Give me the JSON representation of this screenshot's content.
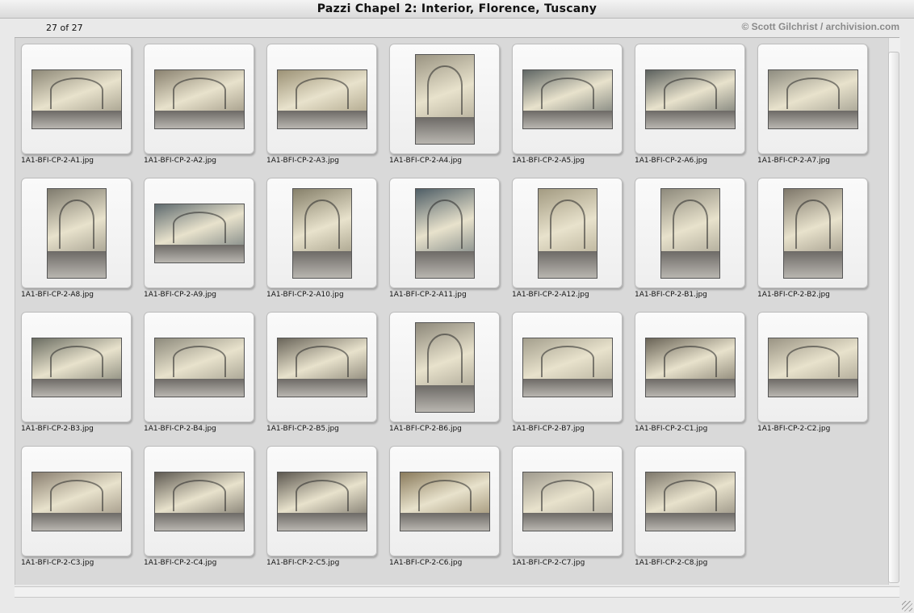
{
  "window": {
    "title": "Pazzi Chapel 2: Interior, Florence, Tuscany"
  },
  "header": {
    "count": "27 of 27",
    "credit": "© Scott Gilchrist / archivision.com"
  },
  "thumbnails": [
    {
      "name": "1A1-BFI-CP-2-A1.jpg",
      "orientation": "landscape",
      "tone": "#8e8978"
    },
    {
      "name": "1A1-BFI-CP-2-A2.jpg",
      "orientation": "landscape",
      "tone": "#8a8270"
    },
    {
      "name": "1A1-BFI-CP-2-A3.jpg",
      "orientation": "landscape",
      "tone": "#9c9276"
    },
    {
      "name": "1A1-BFI-CP-2-A4.jpg",
      "orientation": "portrait",
      "tone": "#9a9482"
    },
    {
      "name": "1A1-BFI-CP-2-A5.jpg",
      "orientation": "landscape",
      "tone": "#5f6664"
    },
    {
      "name": "1A1-BFI-CP-2-A6.jpg",
      "orientation": "landscape",
      "tone": "#5c615e"
    },
    {
      "name": "1A1-BFI-CP-2-A7.jpg",
      "orientation": "landscape",
      "tone": "#8e8c80"
    },
    {
      "name": "1A1-BFI-CP-2-A8.jpg",
      "orientation": "portrait",
      "tone": "#7f7b6e"
    },
    {
      "name": "1A1-BFI-CP-2-A9.jpg",
      "orientation": "landscape",
      "tone": "#5e6a6e"
    },
    {
      "name": "1A1-BFI-CP-2-A10.jpg",
      "orientation": "portrait",
      "tone": "#86806a"
    },
    {
      "name": "1A1-BFI-CP-2-A11.jpg",
      "orientation": "portrait",
      "tone": "#4f5e66"
    },
    {
      "name": "1A1-BFI-CP-2-A12.jpg",
      "orientation": "portrait",
      "tone": "#a39b82"
    },
    {
      "name": "1A1-BFI-CP-2-B1.jpg",
      "orientation": "portrait",
      "tone": "#8e8a7c"
    },
    {
      "name": "1A1-BFI-CP-2-B2.jpg",
      "orientation": "portrait",
      "tone": "#7e776a"
    },
    {
      "name": "1A1-BFI-CP-2-B3.jpg",
      "orientation": "landscape",
      "tone": "#6b6d62"
    },
    {
      "name": "1A1-BFI-CP-2-B4.jpg",
      "orientation": "landscape",
      "tone": "#8d8a7c"
    },
    {
      "name": "1A1-BFI-CP-2-B5.jpg",
      "orientation": "landscape",
      "tone": "#6a655a"
    },
    {
      "name": "1A1-BFI-CP-2-B6.jpg",
      "orientation": "portrait",
      "tone": "#8d887a"
    },
    {
      "name": "1A1-BFI-CP-2-B7.jpg",
      "orientation": "landscape",
      "tone": "#a49f8d"
    },
    {
      "name": "1A1-BFI-CP-2-C1.jpg",
      "orientation": "landscape",
      "tone": "#6a6457"
    },
    {
      "name": "1A1-BFI-CP-2-C2.jpg",
      "orientation": "landscape",
      "tone": "#9a9484"
    },
    {
      "name": "1A1-BFI-CP-2-C3.jpg",
      "orientation": "landscape",
      "tone": "#8a7f70"
    },
    {
      "name": "1A1-BFI-CP-2-C4.jpg",
      "orientation": "landscape",
      "tone": "#5f5a52"
    },
    {
      "name": "1A1-BFI-CP-2-C5.jpg",
      "orientation": "landscape",
      "tone": "#5d5850"
    },
    {
      "name": "1A1-BFI-CP-2-C6.jpg",
      "orientation": "landscape",
      "tone": "#8a7b5c"
    },
    {
      "name": "1A1-BFI-CP-2-C7.jpg",
      "orientation": "landscape",
      "tone": "#9f9a8e"
    },
    {
      "name": "1A1-BFI-CP-2-C8.jpg",
      "orientation": "landscape",
      "tone": "#7e786c"
    }
  ]
}
